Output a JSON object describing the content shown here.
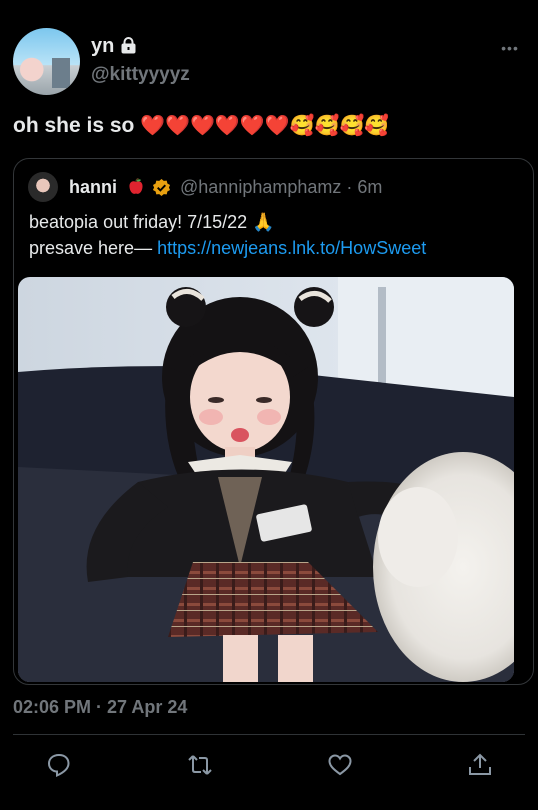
{
  "tweet": {
    "author_name": "yn",
    "author_handle": "@kittyyyyz",
    "text": "oh she is so",
    "emoji": "❤️❤️❤️❤️❤️❤️🥰🥰🥰🥰",
    "timestamp": "02:06 PM · 27 Apr 24"
  },
  "quote": {
    "name": "hanni",
    "handle_time": "@hanniphamphamz · 6m",
    "line1": "beatopia out friday! 7/15/22 🙏",
    "line2_prefix": "presave here— ",
    "link": "https://newjeans.lnk.to/HowSweet"
  },
  "icons": {
    "lock": "lock-icon",
    "more": "more-icon",
    "apple": "red-apple-icon",
    "verified": "verified-badge-icon",
    "reply": "reply-icon",
    "retweet": "retweet-icon",
    "like": "like-icon",
    "share": "share-icon"
  },
  "colors": {
    "background": "#000000",
    "text": "#e7e9ea",
    "muted": "#71767b",
    "link": "#1d9bf0",
    "verified": "#e8a010"
  }
}
